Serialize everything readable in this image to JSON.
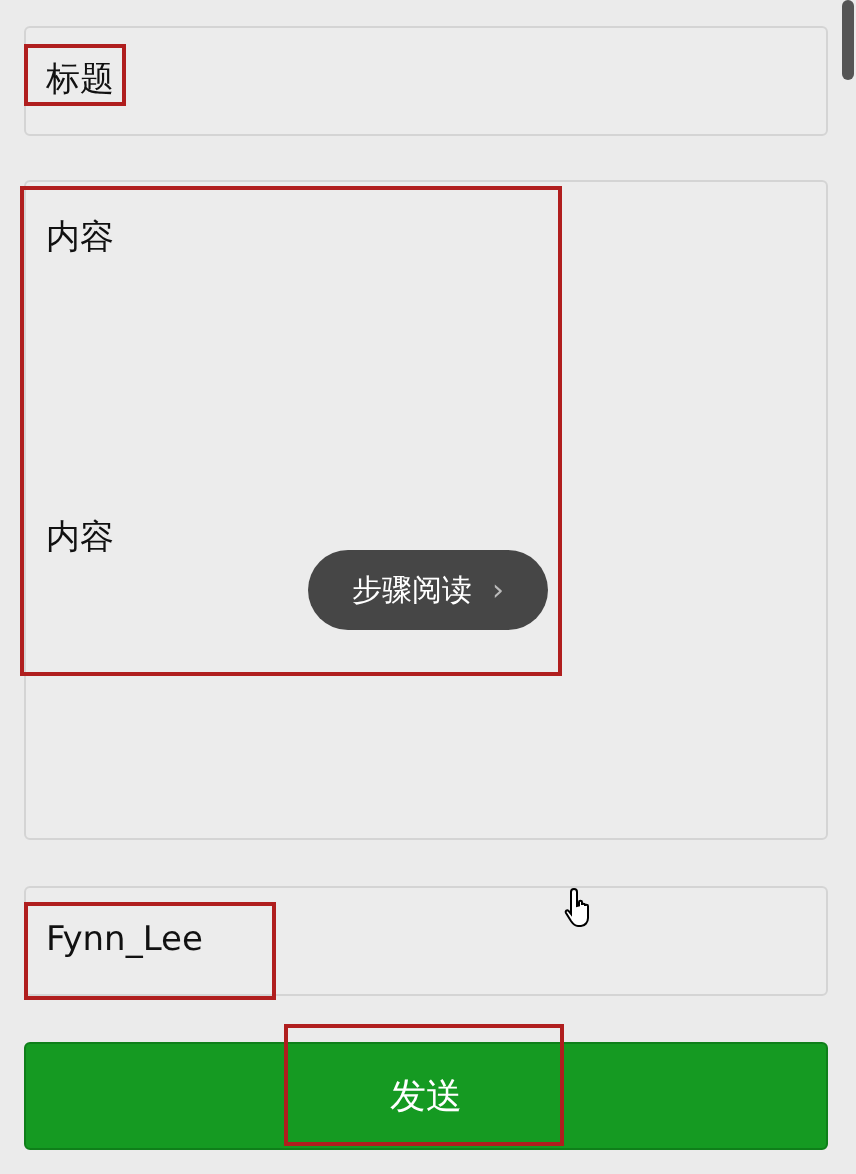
{
  "title_field": {
    "value": "标题"
  },
  "content_field": {
    "lines": [
      "内容",
      "内容"
    ]
  },
  "step_read_button": {
    "label": "步骤阅读",
    "icon": "›"
  },
  "author_field": {
    "value": "Fynn_Lee"
  },
  "send_button": {
    "label": "发送"
  }
}
